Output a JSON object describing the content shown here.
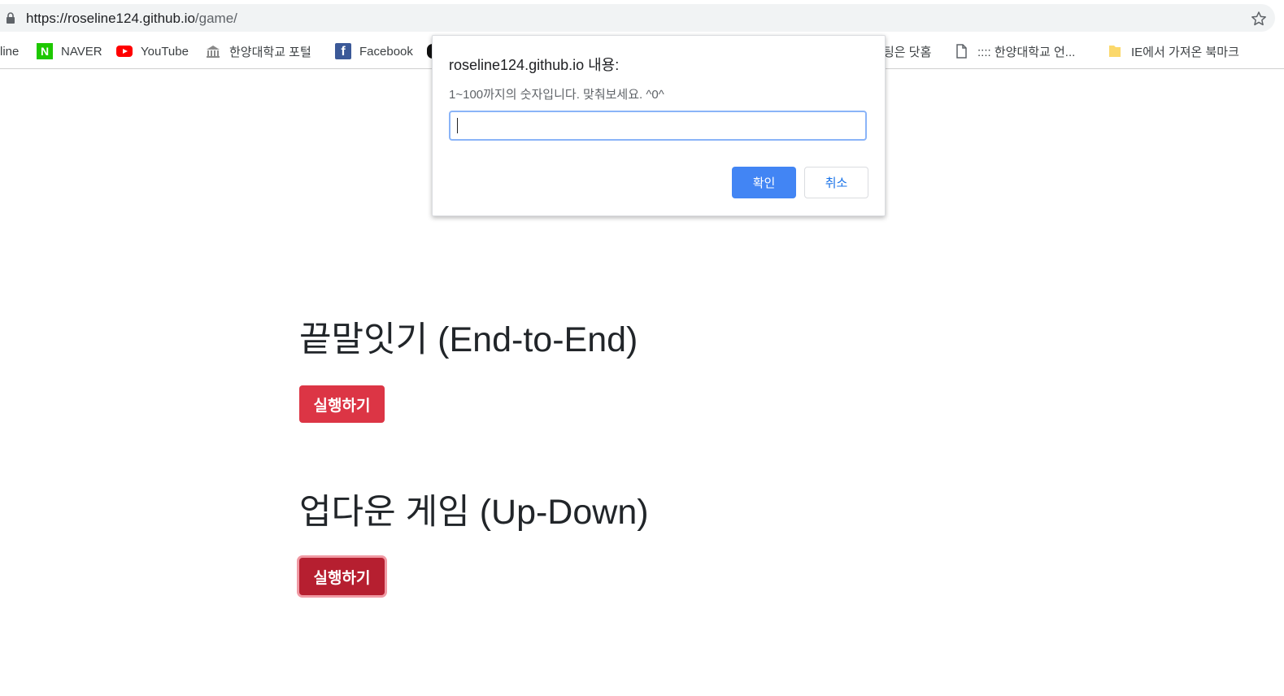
{
  "browser": {
    "url_host": "https://roseline124.github.io",
    "url_path": "/game/"
  },
  "bookmarks": [
    {
      "label": "line",
      "icon": "none"
    },
    {
      "label": "NAVER",
      "icon": "naver-icon"
    },
    {
      "label": "YouTube",
      "icon": "youtube-icon"
    },
    {
      "label": "한양대학교 포털",
      "icon": "university-icon"
    },
    {
      "label": "Facebook",
      "icon": "facebook-icon"
    },
    {
      "label": "팅은 닷홈",
      "icon": "none"
    },
    {
      "label": ":::: 한양대학교 언...",
      "icon": "page-icon"
    },
    {
      "label": "IE에서 가져온 북마크",
      "icon": "folder-icon"
    }
  ],
  "naver_letter": "N",
  "facebook_letter": "f",
  "main": {
    "sections": [
      {
        "title": "끝말잇기 (End-to-End)",
        "button_label": "실행하기"
      },
      {
        "title": "업다운 게임 (Up-Down)",
        "button_label": "실행하기"
      }
    ]
  },
  "dialog": {
    "title": "roseline124.github.io 내용:",
    "message": "1~100까지의 숫자입니다. 맞춰보세요. ^0^",
    "input_value": "",
    "ok_label": "확인",
    "cancel_label": "취소"
  },
  "colors": {
    "danger_button": "#dc3545",
    "ok_button": "#4285f4",
    "cancel_text": "#1a73e8"
  }
}
